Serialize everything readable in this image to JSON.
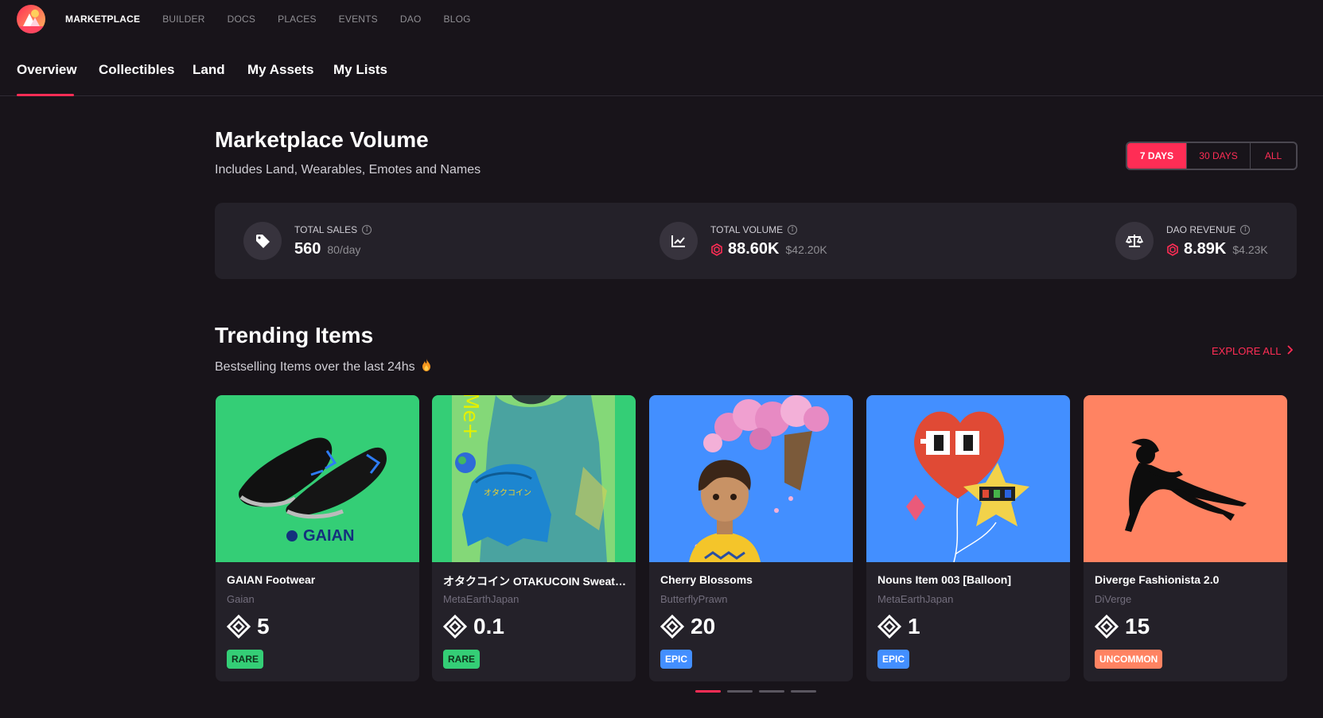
{
  "topnav": {
    "links": [
      "MARKETPLACE",
      "BUILDER",
      "DOCS",
      "PLACES",
      "EVENTS",
      "DAO",
      "BLOG"
    ]
  },
  "subtabs": [
    "Overview",
    "Collectibles",
    "Land",
    "My Assets",
    "My Lists"
  ],
  "volume": {
    "title": "Marketplace Volume",
    "subtitle": "Includes Land, Wearables, Emotes and Names",
    "periods": [
      "7 DAYS",
      "30 DAYS",
      "ALL"
    ],
    "active_period": "7 DAYS",
    "stats": [
      {
        "label": "TOTAL SALES",
        "value": "560",
        "sub": "80/day",
        "icon": "tag-icon"
      },
      {
        "label": "TOTAL VOLUME",
        "value": "88.60K",
        "sub": "$42.20K",
        "icon": "chart-icon"
      },
      {
        "label": "DAO REVENUE",
        "value": "8.89K",
        "sub": "$4.23K",
        "icon": "scale-icon"
      }
    ]
  },
  "trending": {
    "title": "Trending Items",
    "subtitle": "Bestselling Items over the last 24hs",
    "explore_label": "EXPLORE ALL",
    "items": [
      {
        "name": "GAIAN Footwear",
        "creator": "Gaian",
        "price": "5",
        "rarity": "RARE",
        "rarity_color": "#34ce76",
        "bg": "#34ce76",
        "image_text": "GAIAN"
      },
      {
        "name": "オタクコイン OTAKUCOIN Sweats...",
        "creator": "MetaEarthJapan",
        "price": "0.1",
        "rarity": "RARE",
        "rarity_color": "#34ce76",
        "bg": "#34ce76",
        "image_text": "Me+ Japan"
      },
      {
        "name": "Cherry Blossoms",
        "creator": "ButterflyPrawn",
        "price": "20",
        "rarity": "EPIC",
        "rarity_color": "#438fff",
        "bg": "#438fff",
        "image_text": ""
      },
      {
        "name": "Nouns Item 003 [Balloon]",
        "creator": "MetaEarthJapan",
        "price": "1",
        "rarity": "EPIC",
        "rarity_color": "#438fff",
        "bg": "#438fff",
        "image_text": ""
      },
      {
        "name": "Diverge Fashionista 2.0",
        "creator": "DiVerge",
        "price": "15",
        "rarity": "UNCOMMON",
        "rarity_color": "#ff8362",
        "bg": "#ff8362",
        "image_text": ""
      }
    ]
  },
  "colors": {
    "accent": "#ff2d55",
    "background": "#18141a",
    "panel": "#242129"
  }
}
